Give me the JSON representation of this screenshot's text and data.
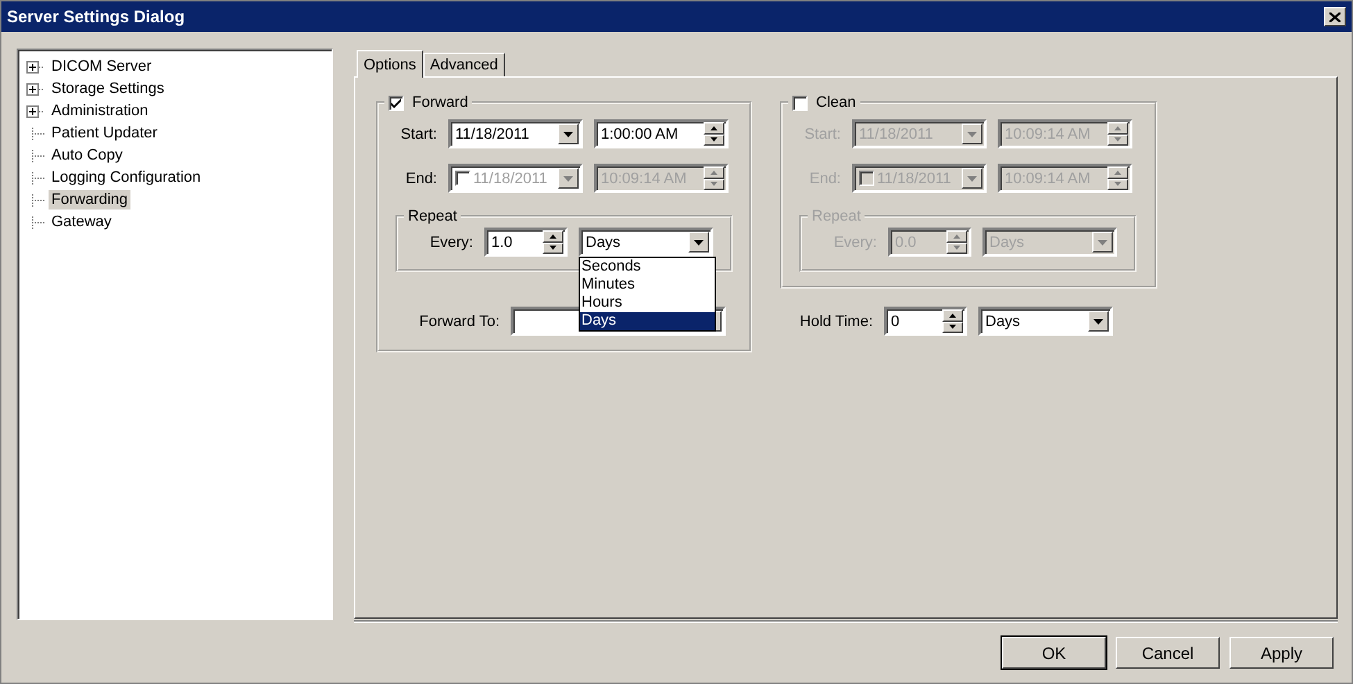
{
  "window": {
    "title": "Server Settings Dialog"
  },
  "tree": [
    {
      "label": "DICOM Server",
      "kind": "collapsed",
      "selected": false
    },
    {
      "label": "Storage Settings",
      "kind": "collapsed",
      "selected": false
    },
    {
      "label": "Administration",
      "kind": "collapsed",
      "selected": false
    },
    {
      "label": "Patient Updater",
      "kind": "leaf",
      "selected": false
    },
    {
      "label": "Auto Copy",
      "kind": "leaf",
      "selected": false
    },
    {
      "label": "Logging Configuration",
      "kind": "leaf",
      "selected": false
    },
    {
      "label": "Forwarding",
      "kind": "leaf",
      "selected": true
    },
    {
      "label": "Gateway",
      "kind": "leaf",
      "selected": false
    }
  ],
  "tabs": [
    {
      "label": "Options",
      "selected": true
    },
    {
      "label": "Advanced",
      "selected": false
    }
  ],
  "forward": {
    "label": "Forward",
    "checked": true,
    "start": {
      "label": "Start:",
      "date": "11/18/2011",
      "time": "1:00:00 AM"
    },
    "end": {
      "label": "End:",
      "checked": false,
      "date": "11/18/2011",
      "time": "10:09:14 AM"
    },
    "repeat": {
      "title": "Repeat",
      "label": "Every:",
      "value": "1.0",
      "unit": "Days",
      "open": true,
      "options": [
        {
          "label": "Seconds",
          "selected": false
        },
        {
          "label": "Minutes",
          "selected": false
        },
        {
          "label": "Hours",
          "selected": false
        },
        {
          "label": "Days",
          "selected": true
        }
      ]
    },
    "forward_to": {
      "label": "Forward To:"
    }
  },
  "clean": {
    "label": "Clean",
    "checked": false,
    "start": {
      "label": "Start:",
      "date": "11/18/2011",
      "time": "10:09:14 AM"
    },
    "end": {
      "label": "End:",
      "checked": false,
      "date": "11/18/2011",
      "time": "10:09:14 AM"
    },
    "repeat": {
      "title": "Repeat",
      "label": "Every:",
      "value": "0.0",
      "unit": "Days",
      "open": false
    }
  },
  "hold_time": {
    "label": "Hold Time:",
    "value": "0",
    "unit": "Days"
  },
  "buttons": [
    {
      "label": "OK",
      "default": true
    },
    {
      "label": "Cancel",
      "default": false
    },
    {
      "label": "Apply",
      "default": false
    }
  ]
}
